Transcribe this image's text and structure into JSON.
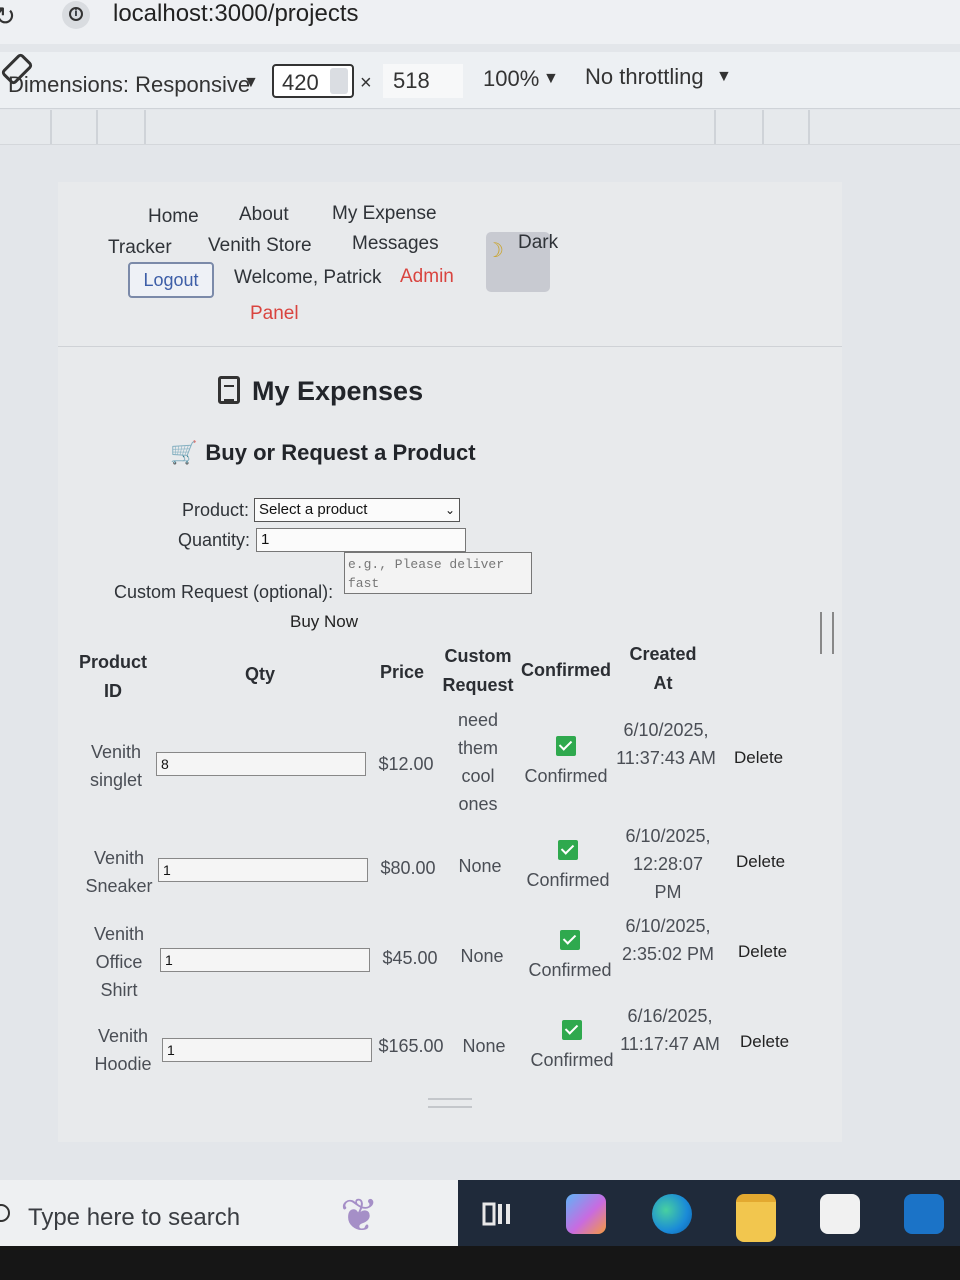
{
  "browser": {
    "url": "localhost:3000/projects"
  },
  "devtools": {
    "dimensions_label": "Dimensions: Responsive",
    "width": "420",
    "times": "×",
    "height": "518",
    "zoom": "100%",
    "throttling": "No throttling"
  },
  "nav": {
    "home": "Home",
    "about": "About",
    "my_expense": "My Expense",
    "tracker": "Tracker",
    "venith_store": "Venith Store",
    "messages": "Messages",
    "logout": "Logout",
    "welcome": "Welcome, Patrick",
    "admin": "Admin",
    "panel": "Panel",
    "dark": "Dark"
  },
  "page_title": "My Expenses",
  "section_title": "Buy or Request a Product",
  "form": {
    "product_label": "Product:",
    "product_value": "Select a product",
    "quantity_label": "Quantity:",
    "quantity_value": "1",
    "custom_label": "Custom Request (optional):",
    "custom_placeholder": "e.g., Please deliver fast",
    "buy_button": "Buy Now"
  },
  "table": {
    "headers": {
      "product_id_1": "Product",
      "product_id_2": "ID",
      "qty": "Qty",
      "price": "Price",
      "custom_1": "Custom",
      "custom_2": "Request",
      "confirmed": "Confirmed",
      "created_1": "Created",
      "created_2": "At"
    },
    "rows": [
      {
        "product": "Venith singlet",
        "qty": "8",
        "price": "$12.00",
        "custom": "need them cool ones",
        "confirmed": "Confirmed",
        "created": "6/10/2025, 11:37:43 AM",
        "action": "Delete"
      },
      {
        "product": "Venith Sneaker",
        "qty": "1",
        "price": "$80.00",
        "custom": "None",
        "confirmed": "Confirmed",
        "created": "6/10/2025, 12:28:07 PM",
        "action": "Delete"
      },
      {
        "product": "Venith Office Shirt",
        "qty": "1",
        "price": "$45.00",
        "custom": "None",
        "confirmed": "Confirmed",
        "created": "6/10/2025, 2:35:02 PM",
        "action": "Delete"
      },
      {
        "product": "Venith Hoodie",
        "qty": "1",
        "price": "$165.00",
        "custom": "None",
        "confirmed": "Confirmed",
        "created": "6/16/2025, 11:17:47 AM",
        "action": "Delete"
      }
    ]
  },
  "taskbar": {
    "search_placeholder": "Type here to search"
  }
}
